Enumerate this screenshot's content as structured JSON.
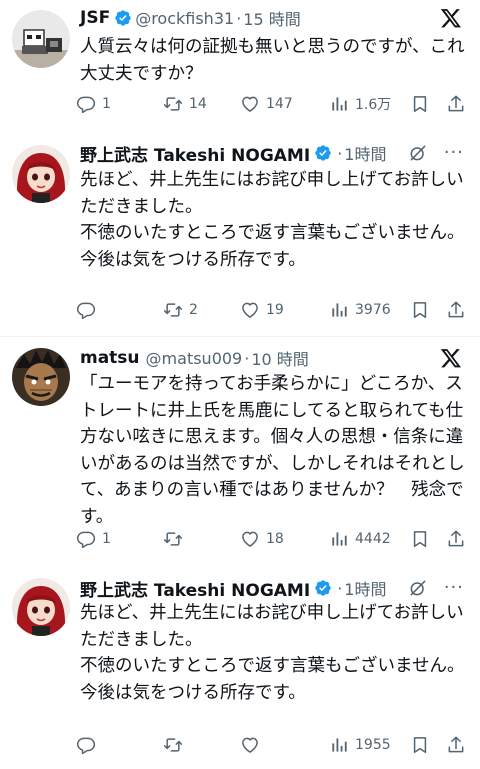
{
  "tweets": [
    {
      "name": "JSF",
      "handle": "@rockfish31",
      "time": "15 時間",
      "text": "人質云々は何の証拠も無いと思うのですが、これ大丈夫ですか？",
      "stats": {
        "replies": "1",
        "reposts": "14",
        "likes": "147",
        "views": "1.6万"
      }
    },
    {
      "name": "野上武志 Takeshi NOGAMI",
      "time": "1時間",
      "text": "先ほど、井上先生にはお詫び申し上げてお許しいただきました。\n不徳のいたすところで返す言葉もございません。\n今後は気をつける所存です。",
      "stats": {
        "replies": "",
        "reposts": "2",
        "likes": "19",
        "views": "3976"
      }
    },
    {
      "name": "matsu",
      "handle": "@matsu009",
      "time": "10 時間",
      "text": "「ユーモアを持ってお手柔らかに」どころか、ストレートに井上氏を馬鹿にしてると取られても仕方ない呟きに思えます。個々人の思想・信条に違いがあるのは当然ですが、しかしそれはそれとして、あまりの言い種ではありませんか？　残念です。",
      "stats": {
        "replies": "1",
        "reposts": "",
        "likes": "18",
        "views": "4442"
      }
    },
    {
      "name": "野上武志 Takeshi NOGAMI",
      "time": "1時間",
      "text": "先ほど、井上先生にはお詫び申し上げてお許しいただきました。\n不徳のいたすところで返す言葉もございません。\n今後は気をつける所存です。",
      "stats": {
        "replies": "",
        "reposts": "",
        "likes": "",
        "views": "1955"
      }
    }
  ],
  "icons": {
    "verified": "verified-badge-icon",
    "platform": "x-logo-icon",
    "grok": "grok-icon",
    "more": "more-icon",
    "reply": "reply-icon",
    "repost": "repost-icon",
    "like": "like-icon",
    "views": "views-icon",
    "bookmark": "bookmark-icon",
    "share": "share-icon"
  },
  "colors": {
    "verified": "#1d9bf0",
    "secondary_text": "#536471",
    "text": "#0f1419",
    "divider": "#eff3f4"
  }
}
